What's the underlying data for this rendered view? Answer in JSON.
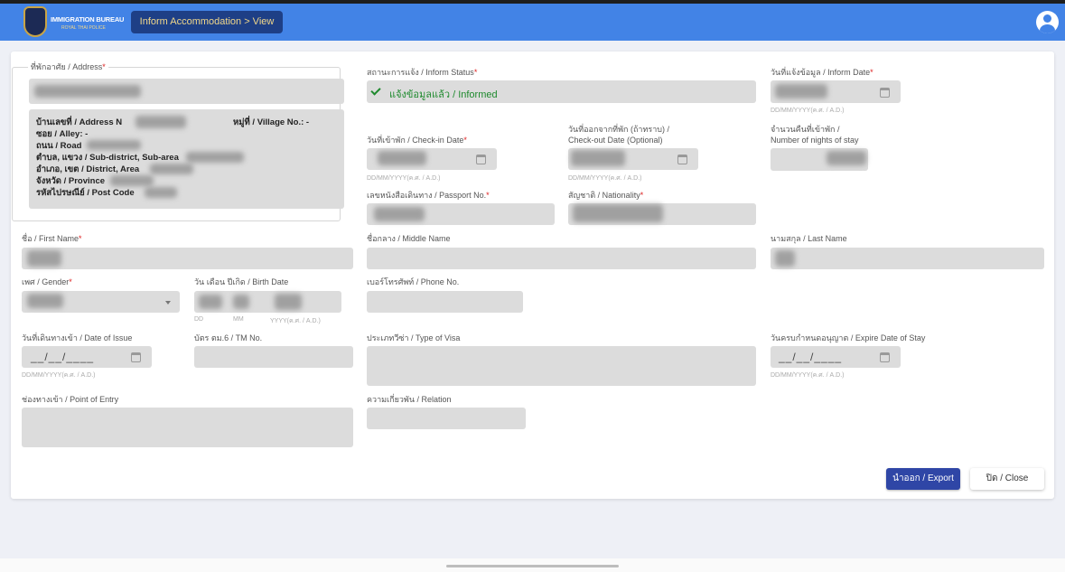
{
  "header": {
    "logo_line1": "IMMIGRATION BUREAU",
    "logo_line2": "ROYAL THAI POLICE",
    "breadcrumb": "Inform Accommodation > View",
    "user_icon": "account-circle-icon"
  },
  "address": {
    "legend": "ที่พักอาศัย / Address",
    "lines": {
      "address_no": "บ้านเลขที่ / Address N",
      "village": "หมู่ที่ / Village No.: -",
      "alley": "ซอย / Alley: -",
      "road": "ถนน / Road",
      "subdistrict": "ตำบล, แขวง / Sub-district, Sub-area",
      "district": "อำเภอ, เขต / District, Area",
      "province": "จังหวัด / Province",
      "postcode": "รหัสไปรษณีย์ / Post Code"
    }
  },
  "inform_status": {
    "label": "สถานะการแจ้ง / Inform Status",
    "value": "แจ้งข้อมูลแล้ว / Informed"
  },
  "inform_date": {
    "label": "วันที่แจ้งข้อมูล / Inform Date",
    "hint": "DD/MM/YYYY(ค.ศ. / A.D.)"
  },
  "checkin": {
    "label": "วันที่เข้าพัก / Check-in Date",
    "hint": "DD/MM/YYYY(ค.ศ. / A.D.)"
  },
  "checkout": {
    "label1": "วันที่ออกจากที่พัก (ถ้าทราบ) /",
    "label2": "Check-out Date (Optional)",
    "hint": "DD/MM/YYYY(ค.ศ. / A.D.)"
  },
  "nights": {
    "label1": "จำนวนคืนที่เข้าพัก /",
    "label2": "Number of nights of stay"
  },
  "passport": {
    "label": "เลขหนังสือเดินทาง / Passport No."
  },
  "nationality": {
    "label": "สัญชาติ / Nationality"
  },
  "first_name": {
    "label": "ชื่อ / First Name"
  },
  "middle_name": {
    "label": "ชื่อกลาง / Middle Name"
  },
  "last_name": {
    "label": "นามสกุล / Last Name"
  },
  "gender": {
    "label": "เพศ / Gender"
  },
  "birth_date": {
    "label": "วัน เดือน ปีเกิด / Birth Date",
    "hint_dd": "DD",
    "hint_mm": "MM",
    "hint_yyyy": "YYYY(ค.ศ. / A.D.)"
  },
  "phone": {
    "label": "เบอร์โทรศัพท์ / Phone No."
  },
  "date_of_issue": {
    "label": "วันที่เดินทางเข้า / Date of Issue",
    "value": "__/__/____",
    "hint": "DD/MM/YYYY(ค.ศ. / A.D.)"
  },
  "tm_no": {
    "label": "บัตร ตม.6 / TM No."
  },
  "visa_type": {
    "label": "ประเภทวีซ่า / Type of Visa"
  },
  "expire_date": {
    "label": "วันครบกำหนดอนุญาต / Expire Date of Stay",
    "value": "__/__/____",
    "hint": "DD/MM/YYYY(ค.ศ. / A.D.)"
  },
  "point_of_entry": {
    "label": "ช่องทางเข้า / Point of Entry"
  },
  "relation": {
    "label": "ความเกี่ยวพัน / Relation"
  },
  "actions": {
    "export": "นำออก / Export",
    "close": "ปิด / Close"
  }
}
